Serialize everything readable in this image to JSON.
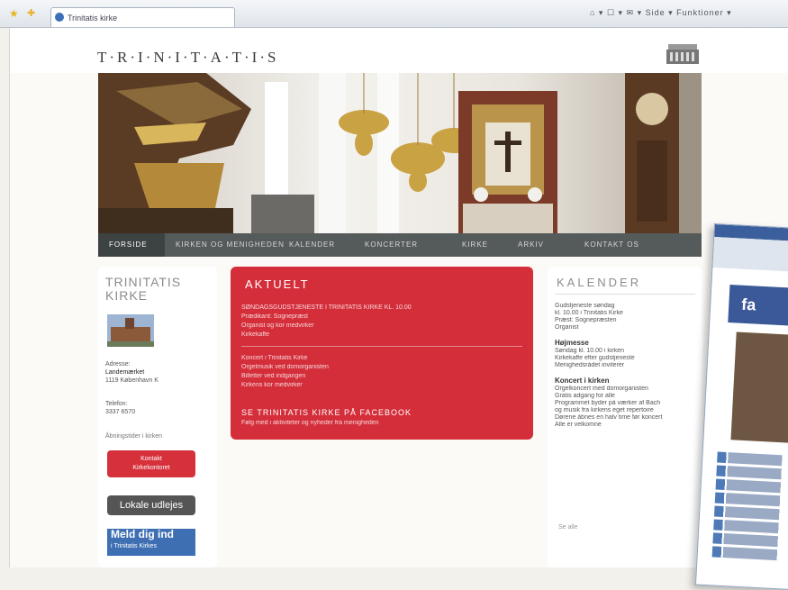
{
  "browser": {
    "tab_title": "Trinitatis kirke",
    "tools_text": "⌂ ▾ ☐ ▾ ✉ ▾ Side ▾ Funktioner ▾"
  },
  "site": {
    "logo": "T·R·I·N·I·T·A·T·I·S"
  },
  "nav": {
    "items": [
      {
        "label": "FORSIDE"
      },
      {
        "label": "KIRKEN OG MENIGHEDEN"
      },
      {
        "label": "KALENDER"
      },
      {
        "label": "KONCERTER"
      },
      {
        "label": "KIRKE"
      },
      {
        "label": "ARKIV"
      },
      {
        "label": "KONTAKT OS"
      }
    ]
  },
  "left": {
    "title": "TRINITATIS KIRKE",
    "address_label": "Adresse:",
    "address_1": "Landemærket",
    "address_2": "1119 København K",
    "phone_label": "Telefon:",
    "phone": "3337 6570",
    "hours": "Åbningstider i kirken",
    "red_button_line1": "Kontakt",
    "red_button_line2": "Kirkekontoret",
    "gray_button": "Lokale udlejes",
    "blue_button": "Meld dig ind",
    "blue_button_sub": "i Trinitatis Kirkes"
  },
  "mid": {
    "title": "AKTUELT",
    "lines_a": [
      "SØNDAGSGUDSTJENESTE I TRINITATIS KIRKE KL. 10.00",
      "Prædikant: Sognepræst",
      "Organist og kor medvirker",
      "Kirkekaffe"
    ],
    "lines_b": [
      "Koncert i Trinitatis Kirke",
      "Orgelmusik ved domorganisten",
      "Billetter ved indgangen",
      "Kirkens kor medvirker"
    ],
    "link": "SE TRINITATIS KIRKE PÅ FACEBOOK",
    "link_sub": "Følg med i aktiviteter og nyheder fra menigheden"
  },
  "right": {
    "title": "KALENDER",
    "block1": [
      "Gudstjeneste søndag",
      "kl. 10.00 i Trinitatis Kirke",
      "Præst: Sognepræsten",
      "Organist"
    ],
    "head2": "Højmesse",
    "block2": [
      "Søndag kl. 10.00 i kirken",
      "Kirkekaffe efter gudstjeneste",
      "Menighedsrådet inviterer"
    ],
    "head3": "Koncert i kirken",
    "block3": [
      "Orgelkoncert med domorganisten",
      "Gratis adgang for alle",
      "Programmet byder på værker af Bach",
      "og musik fra kirkens eget repertoire",
      "Dørene åbnes en halv time før koncert",
      "Alle er velkomne"
    ],
    "more": "Se alle"
  },
  "popup": {
    "brand": "fa"
  },
  "colors": {
    "red": "#d42e3a",
    "nav": "#555a5a",
    "facebook": "#3b5998"
  }
}
